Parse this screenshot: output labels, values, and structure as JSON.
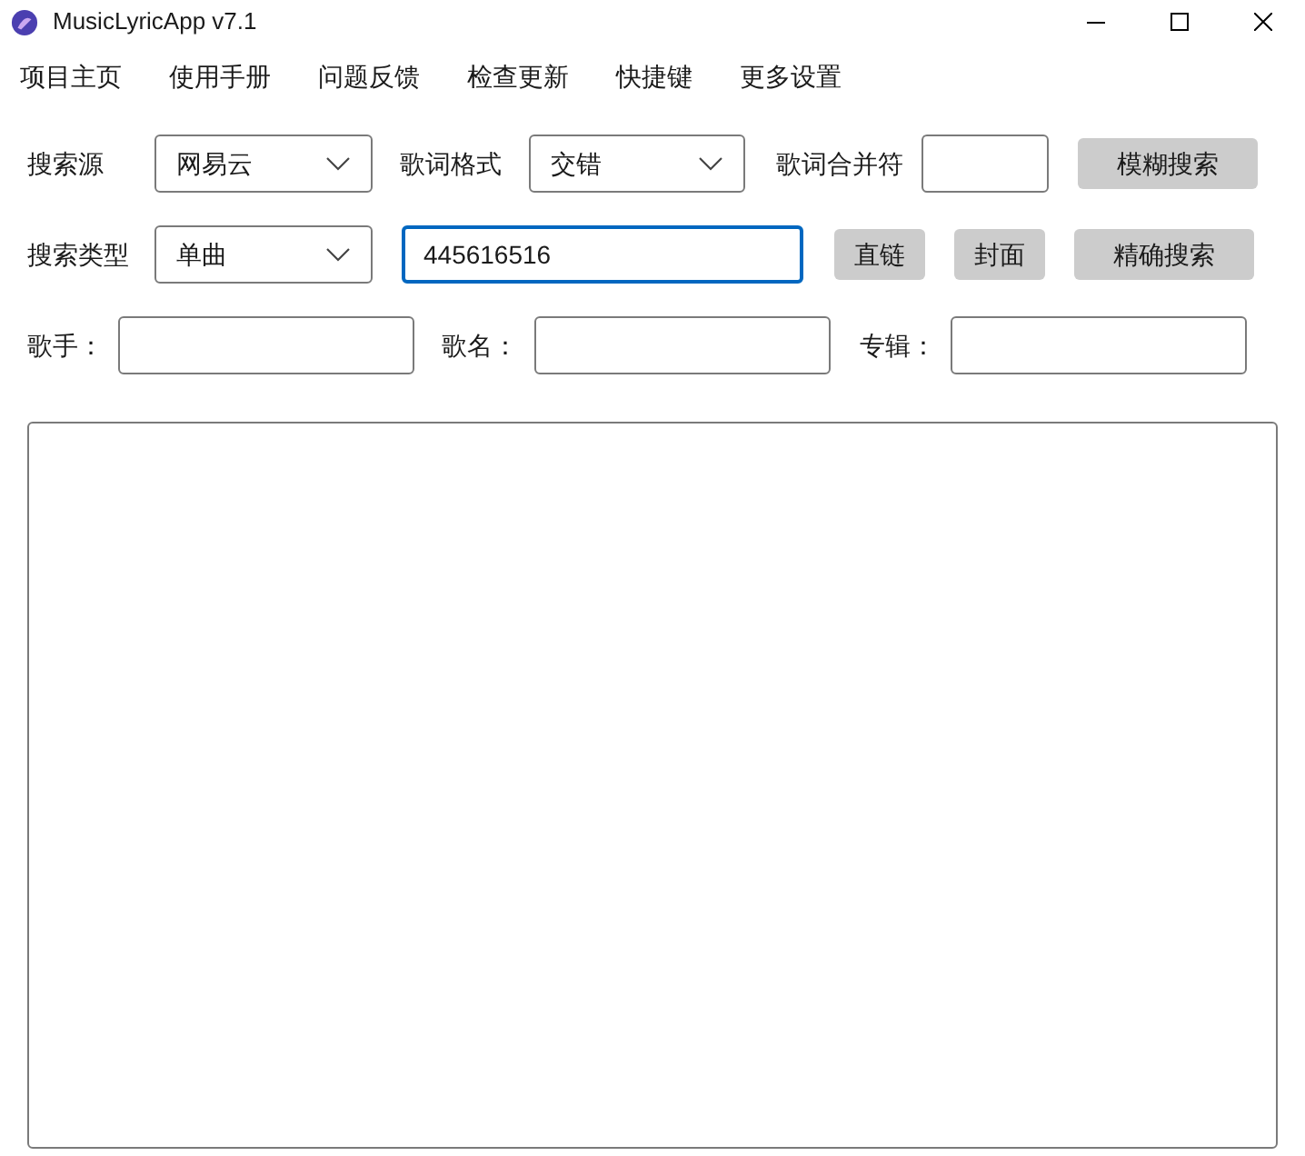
{
  "window": {
    "title": "MusicLyricApp v7.1"
  },
  "menu": [
    "项目主页",
    "使用手册",
    "问题反馈",
    "检查更新",
    "快捷键",
    "更多设置"
  ],
  "search_source": {
    "label": "搜索源",
    "value": "网易云"
  },
  "lyric_format": {
    "label": "歌词格式",
    "value": "交错"
  },
  "lyric_separator": {
    "label": "歌词合并符"
  },
  "fuzzy_search_button": "模糊搜索",
  "search_type": {
    "label": "搜索类型",
    "value": "单曲"
  },
  "search_id": {
    "value": "445616516",
    "focused": true
  },
  "direct_link_button": "直链",
  "cover_button": "封面",
  "exact_search_button": "精确搜索",
  "singer": {
    "label": "歌手："
  },
  "song_name": {
    "label": "歌名："
  },
  "album": {
    "label": "专辑："
  }
}
